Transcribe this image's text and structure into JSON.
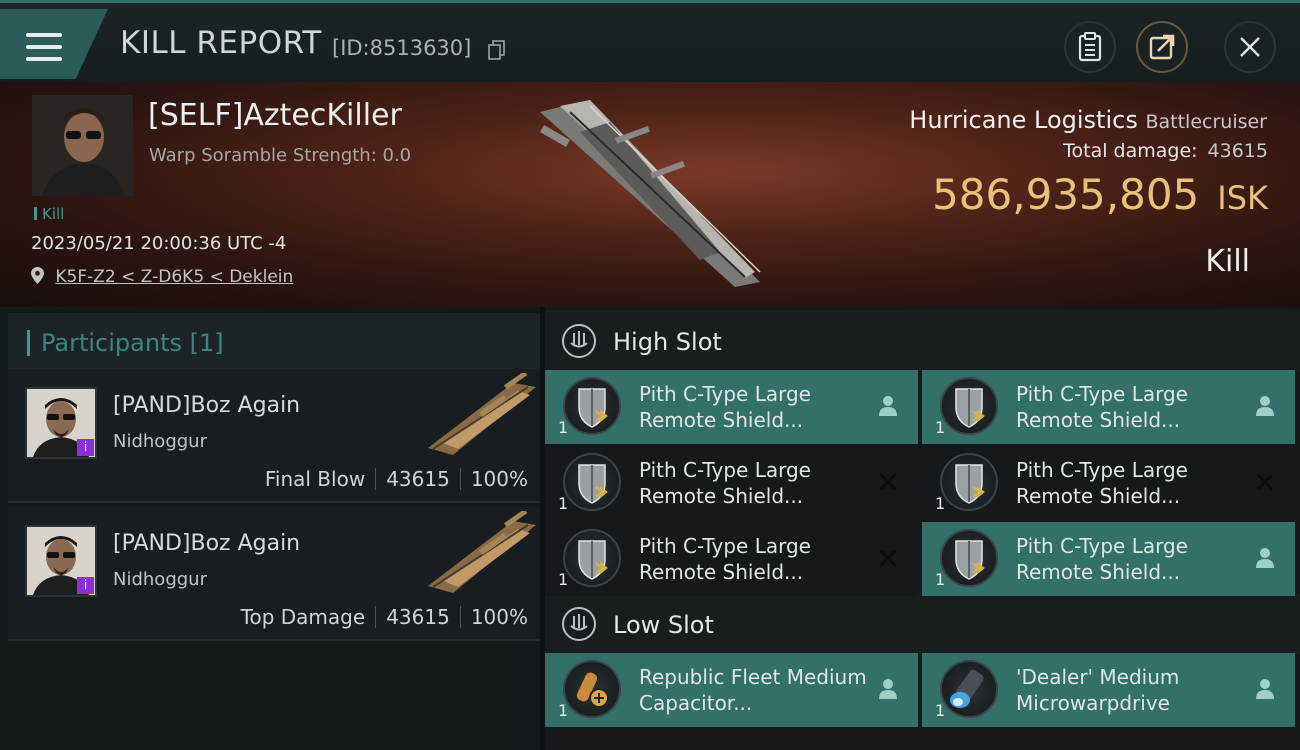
{
  "header": {
    "title": "KILL REPORT",
    "report_id": "[ID:8513630]",
    "buttons": [
      "clipboard-icon",
      "share-icon",
      "close-icon"
    ]
  },
  "victim": {
    "name": "[SELF]AztecKiller",
    "warp_scramble": "Warp Soramble Strength: 0.0",
    "tag": "Kill",
    "datetime": "2023/05/21 20:00:36 UTC -4",
    "location": "K5F-Z2 < Z-D6K5 < Deklein",
    "ship_name": "Hurricane Logistics",
    "ship_class": "Battlecruiser",
    "total_damage_label": "Total damage:",
    "total_damage": "43615",
    "isk_value": "586,935,805",
    "isk_unit": "ISK",
    "result": "Kill"
  },
  "participants": {
    "title": "Participants [1]",
    "rows": [
      {
        "name": "[PAND]Boz Again",
        "ship": "Nidhoggur",
        "role": "Final Blow",
        "damage": "43615",
        "percent": "100%"
      },
      {
        "name": "[PAND]Boz Again",
        "ship": "Nidhoggur",
        "role": "Top Damage",
        "damage": "43615",
        "percent": "100%"
      }
    ]
  },
  "slots": {
    "high": {
      "title": "High Slot",
      "modules": [
        {
          "name": "Pith C-Type Large Remote Shield...",
          "qty": "1",
          "state": "active",
          "status_icon": "pilot-icon"
        },
        {
          "name": "Pith C-Type Large Remote Shield...",
          "qty": "1",
          "state": "active",
          "status_icon": "pilot-icon"
        },
        {
          "name": "Pith C-Type Large Remote Shield...",
          "qty": "1",
          "state": "inactive",
          "status_icon": "destroyed-x-icon"
        },
        {
          "name": "Pith C-Type Large Remote Shield...",
          "qty": "1",
          "state": "inactive",
          "status_icon": "destroyed-x-icon"
        },
        {
          "name": "Pith C-Type Large Remote Shield...",
          "qty": "1",
          "state": "inactive",
          "status_icon": "destroyed-x-icon"
        },
        {
          "name": "Pith C-Type Large Remote Shield...",
          "qty": "1",
          "state": "active",
          "status_icon": "pilot-icon"
        }
      ]
    },
    "low": {
      "title": "Low Slot",
      "modules": [
        {
          "name": "Republic Fleet Medium Capacitor...",
          "qty": "1",
          "state": "active",
          "status_icon": "pilot-icon"
        },
        {
          "name": "'Dealer' Medium Microwarpdrive",
          "qty": "1",
          "state": "active",
          "status_icon": "pilot-icon"
        }
      ]
    }
  },
  "colors": {
    "accent": "#3f9a8f",
    "isk": "#e9c27a",
    "active_slot": "#34706a"
  }
}
